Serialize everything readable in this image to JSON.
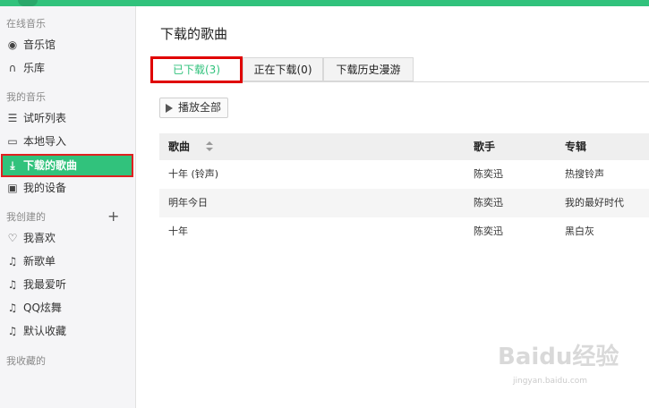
{
  "sidebar": {
    "sections": [
      {
        "title": "在线音乐",
        "items": [
          {
            "label": "音乐馆",
            "icon": "music-hall-icon",
            "glyph": "◉"
          },
          {
            "label": "乐库",
            "icon": "headphones-icon",
            "glyph": "∩"
          }
        ]
      },
      {
        "title": "我的音乐",
        "items": [
          {
            "label": "试听列表",
            "icon": "list-icon",
            "glyph": "☰"
          },
          {
            "label": "本地导入",
            "icon": "monitor-icon",
            "glyph": "▭"
          },
          {
            "label": "下载的歌曲",
            "icon": "download-icon",
            "glyph": "⤓"
          },
          {
            "label": "我的设备",
            "icon": "device-icon",
            "glyph": "▣"
          }
        ]
      },
      {
        "title": "我创建的",
        "items": [
          {
            "label": "我喜欢",
            "icon": "heart-icon",
            "glyph": "♡"
          },
          {
            "label": "新歌单",
            "icon": "music-note-icon",
            "glyph": "♫"
          },
          {
            "label": "我最爱听",
            "icon": "music-note-icon",
            "glyph": "♫"
          },
          {
            "label": "QQ炫舞",
            "icon": "music-note-icon",
            "glyph": "♫"
          },
          {
            "label": "默认收藏",
            "icon": "music-note-icon",
            "glyph": "♫"
          }
        ]
      },
      {
        "title": "我收藏的",
        "items": []
      }
    ],
    "plus_glyph": "+"
  },
  "main": {
    "title": "下载的歌曲",
    "tabs": [
      {
        "label": "已下载(3)",
        "selected": true
      },
      {
        "label": "正在下载(0)",
        "selected": false
      },
      {
        "label": "下载历史漫游",
        "selected": false
      }
    ],
    "play_all_label": "播放全部",
    "table": {
      "headers": {
        "song": "歌曲",
        "artist": "歌手",
        "album": "专辑"
      },
      "rows": [
        {
          "song": "十年 (铃声)",
          "artist": "陈奕迅",
          "album": "热搜铃声"
        },
        {
          "song": "明年今日",
          "artist": "陈奕迅",
          "album": "我的最好时代"
        },
        {
          "song": "十年",
          "artist": "陈奕迅",
          "album": "黑白灰"
        }
      ]
    }
  },
  "watermark": {
    "text": "Baidu经验",
    "sub": "jingyan.baidu.com"
  },
  "colors": {
    "accent": "#31c27c",
    "highlight": "#e00000"
  }
}
